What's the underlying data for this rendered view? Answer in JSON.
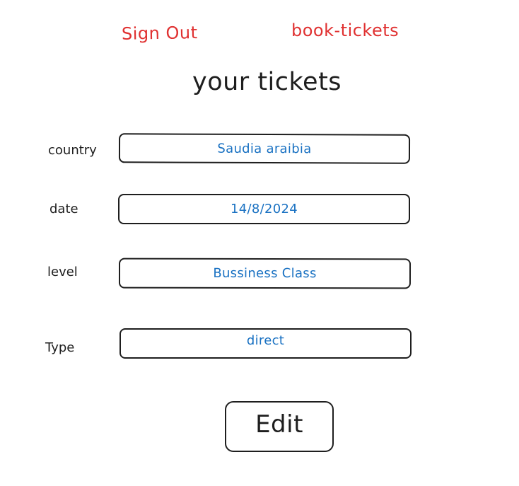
{
  "header": {
    "sign_out_label": "Sign Out",
    "book_tickets_label": "book-tickets"
  },
  "page": {
    "title": "your tickets"
  },
  "form": {
    "country": {
      "label": "country",
      "value": "Saudia araibia"
    },
    "date": {
      "label": "date",
      "value": "14/8/2024"
    },
    "level": {
      "label": "level",
      "value": "Bussiness Class"
    },
    "type": {
      "label": "Type",
      "value": "direct"
    }
  },
  "actions": {
    "edit_label": "Edit"
  },
  "colors": {
    "link": "#e03131",
    "value_text": "#1971c2",
    "stroke": "#1e1e1e"
  }
}
